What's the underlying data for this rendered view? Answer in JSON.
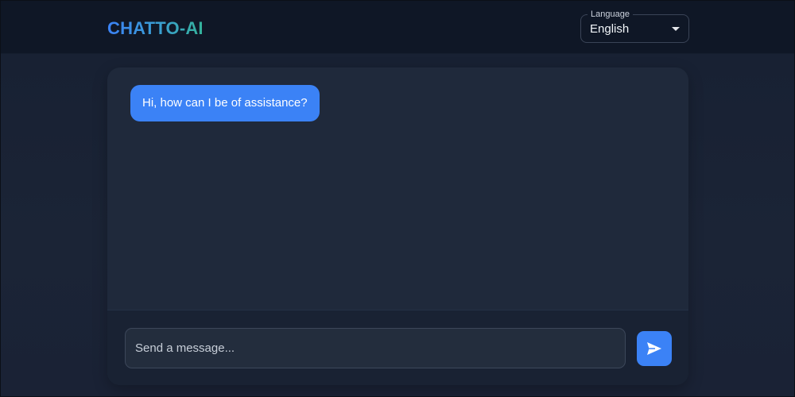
{
  "header": {
    "brand": "CHATTO-AI",
    "language": {
      "label": "Language",
      "selected": "English"
    }
  },
  "chat": {
    "messages": [
      {
        "role": "assistant",
        "text": "Hi, how can I be of assistance?"
      }
    ],
    "composer": {
      "placeholder": "Send a message...",
      "value": ""
    }
  },
  "icons": {
    "send": "send-icon",
    "dropdown": "chevron-down-icon"
  },
  "colors": {
    "accent": "#3b82f6",
    "brand_gradient_start": "#3b82f6",
    "brand_gradient_end": "#34b39a",
    "header_bg": "#0f1726",
    "card_bg": "#1f293b"
  }
}
